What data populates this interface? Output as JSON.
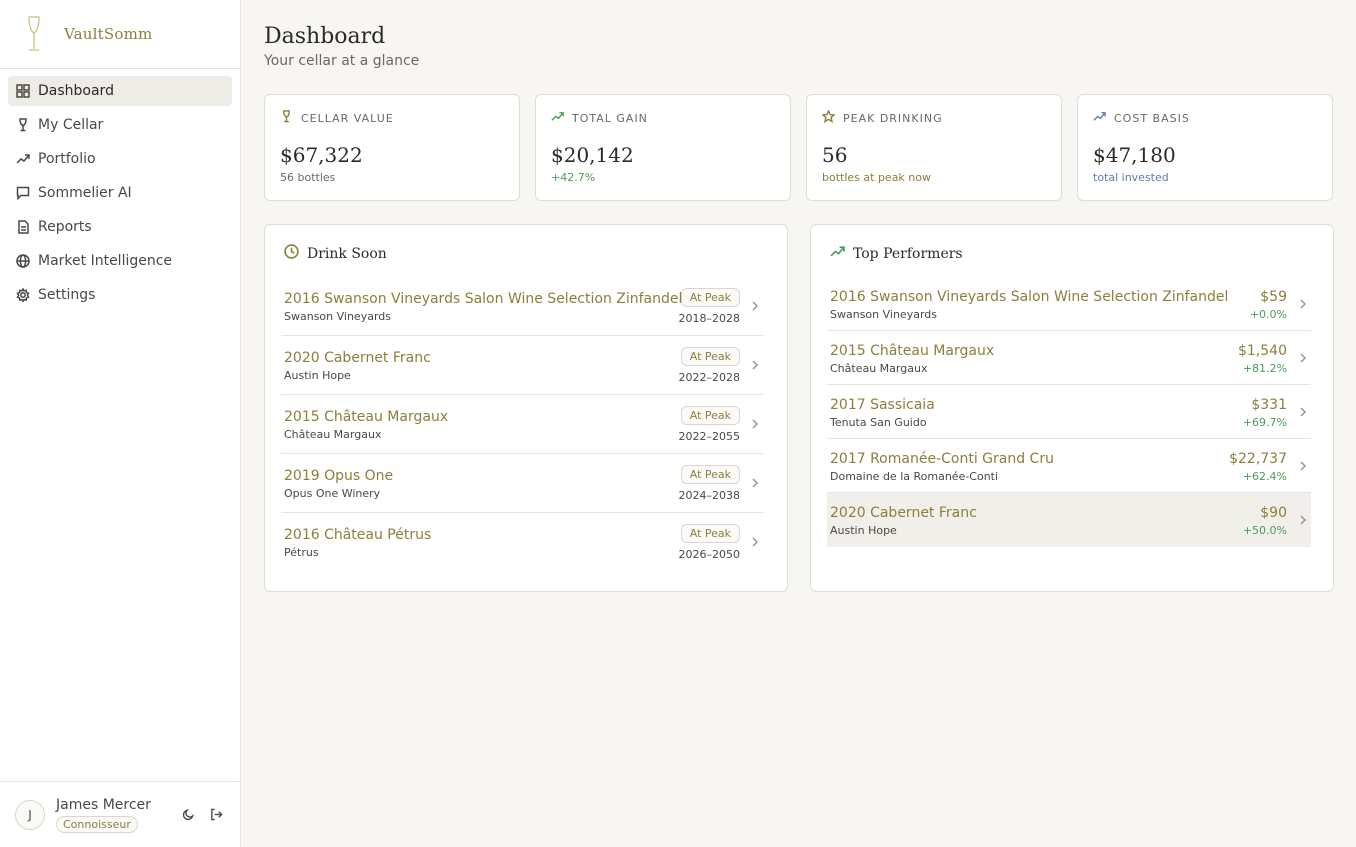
{
  "app": {
    "name": "VaultSomm"
  },
  "nav": {
    "items": [
      {
        "label": "Dashboard",
        "icon": "grid-icon",
        "active": true
      },
      {
        "label": "My Cellar",
        "icon": "wine-glass-icon",
        "active": false
      },
      {
        "label": "Portfolio",
        "icon": "trend-up-icon",
        "active": false
      },
      {
        "label": "Sommelier AI",
        "icon": "chat-icon",
        "active": false
      },
      {
        "label": "Reports",
        "icon": "document-icon",
        "active": false
      },
      {
        "label": "Market Intelligence",
        "icon": "globe-icon",
        "active": false
      },
      {
        "label": "Settings",
        "icon": "gear-icon",
        "active": false
      }
    ]
  },
  "user": {
    "initial": "J",
    "name": "James Mercer",
    "tier": "Connoisseur"
  },
  "header": {
    "title": "Dashboard",
    "subtitle": "Your cellar at a glance"
  },
  "stats": [
    {
      "label": "Cellar Value",
      "icon": "wine-glass-icon",
      "value": "$67,322",
      "sub": "56 bottles"
    },
    {
      "label": "Total Gain",
      "icon": "trend-up-icon",
      "value": "$20,142",
      "sub": "+42.7%"
    },
    {
      "label": "Peak Drinking",
      "icon": "star-icon",
      "value": "56",
      "sub": "bottles at peak now"
    },
    {
      "label": "Cost Basis",
      "icon": "trend-up-icon",
      "value": "$47,180",
      "sub": "total invested"
    }
  ],
  "drink_soon": {
    "title": "Drink Soon",
    "rows": [
      {
        "name": "2016 Swanson Vineyards Salon Wine Selection Zinfandel",
        "producer": "Swanson Vineyards",
        "badge": "At Peak",
        "window": "2018–2028"
      },
      {
        "name": "2020 Cabernet Franc",
        "producer": "Austin Hope",
        "badge": "At Peak",
        "window": "2022–2028"
      },
      {
        "name": "2015 Château Margaux",
        "producer": "Château Margaux",
        "badge": "At Peak",
        "window": "2022–2055"
      },
      {
        "name": "2019 Opus One",
        "producer": "Opus One Winery",
        "badge": "At Peak",
        "window": "2024–2038"
      },
      {
        "name": "2016 Château Pétrus",
        "producer": "Pétrus",
        "badge": "At Peak",
        "window": "2026–2050"
      }
    ]
  },
  "top_performers": {
    "title": "Top Performers",
    "rows": [
      {
        "name": "2016 Swanson Vineyards Salon Wine Selection Zinfandel",
        "producer": "Swanson Vineyards",
        "value": "$59",
        "change": "+0.0%"
      },
      {
        "name": "2015 Château Margaux",
        "producer": "Château Margaux",
        "value": "$1,540",
        "change": "+81.2%"
      },
      {
        "name": "2017 Sassicaia",
        "producer": "Tenuta San Guido",
        "value": "$331",
        "change": "+69.7%"
      },
      {
        "name": "2017 Romanée-Conti Grand Cru",
        "producer": "Domaine de la Romanée-Conti",
        "value": "$22,737",
        "change": "+62.4%"
      },
      {
        "name": "2020 Cabernet Franc",
        "producer": "Austin Hope",
        "value": "$90",
        "change": "+50.0%"
      }
    ]
  },
  "colors": {
    "accent": "#8a7f3c",
    "positive": "#4c9a5a",
    "info": "#5a7fa8"
  }
}
